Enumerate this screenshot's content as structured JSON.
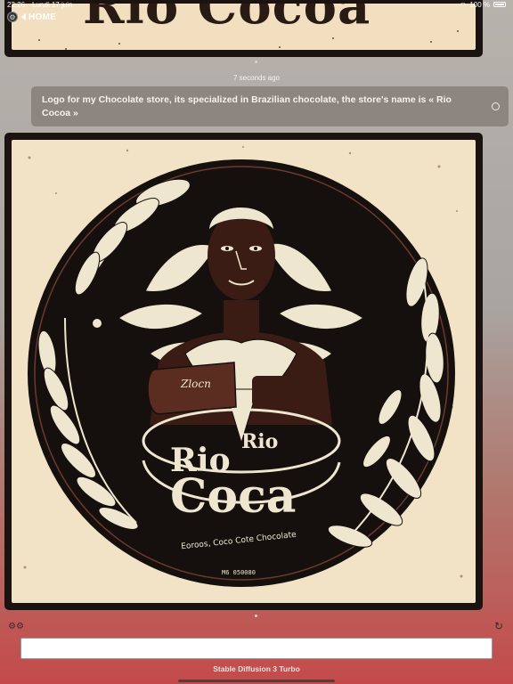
{
  "status_bar": {
    "time": "22:26",
    "date": "Lundi 17 juin",
    "battery": "100 %"
  },
  "nav": {
    "home_label": "HOME"
  },
  "previous_result": {
    "title_text": "Rio Cocoa"
  },
  "conversation": {
    "timestamp": "7 seconds ago",
    "prompt": "Logo for my Chocolate store, its specialized in Brazilian chocolate, the store's name is « Rio Cocoa »"
  },
  "generated_image": {
    "wrapper_label": "Zlocn",
    "brand_line1": "Rio",
    "brand_line2": "Rio",
    "brand_line3": "Coca",
    "tagline": "Eoroos, Coco Cote Chocolate",
    "code": "M6 050080"
  },
  "composer": {
    "input_value": "",
    "input_placeholder": "",
    "model_name": "Stable Diffusion 3 Turbo"
  },
  "colors": {
    "card_border": "#1b1310",
    "image_bg": "#f3e3c6",
    "circle_dark": "#15100d",
    "leaf_cream": "#efe6cf",
    "accent_brown": "#5a2d20"
  }
}
